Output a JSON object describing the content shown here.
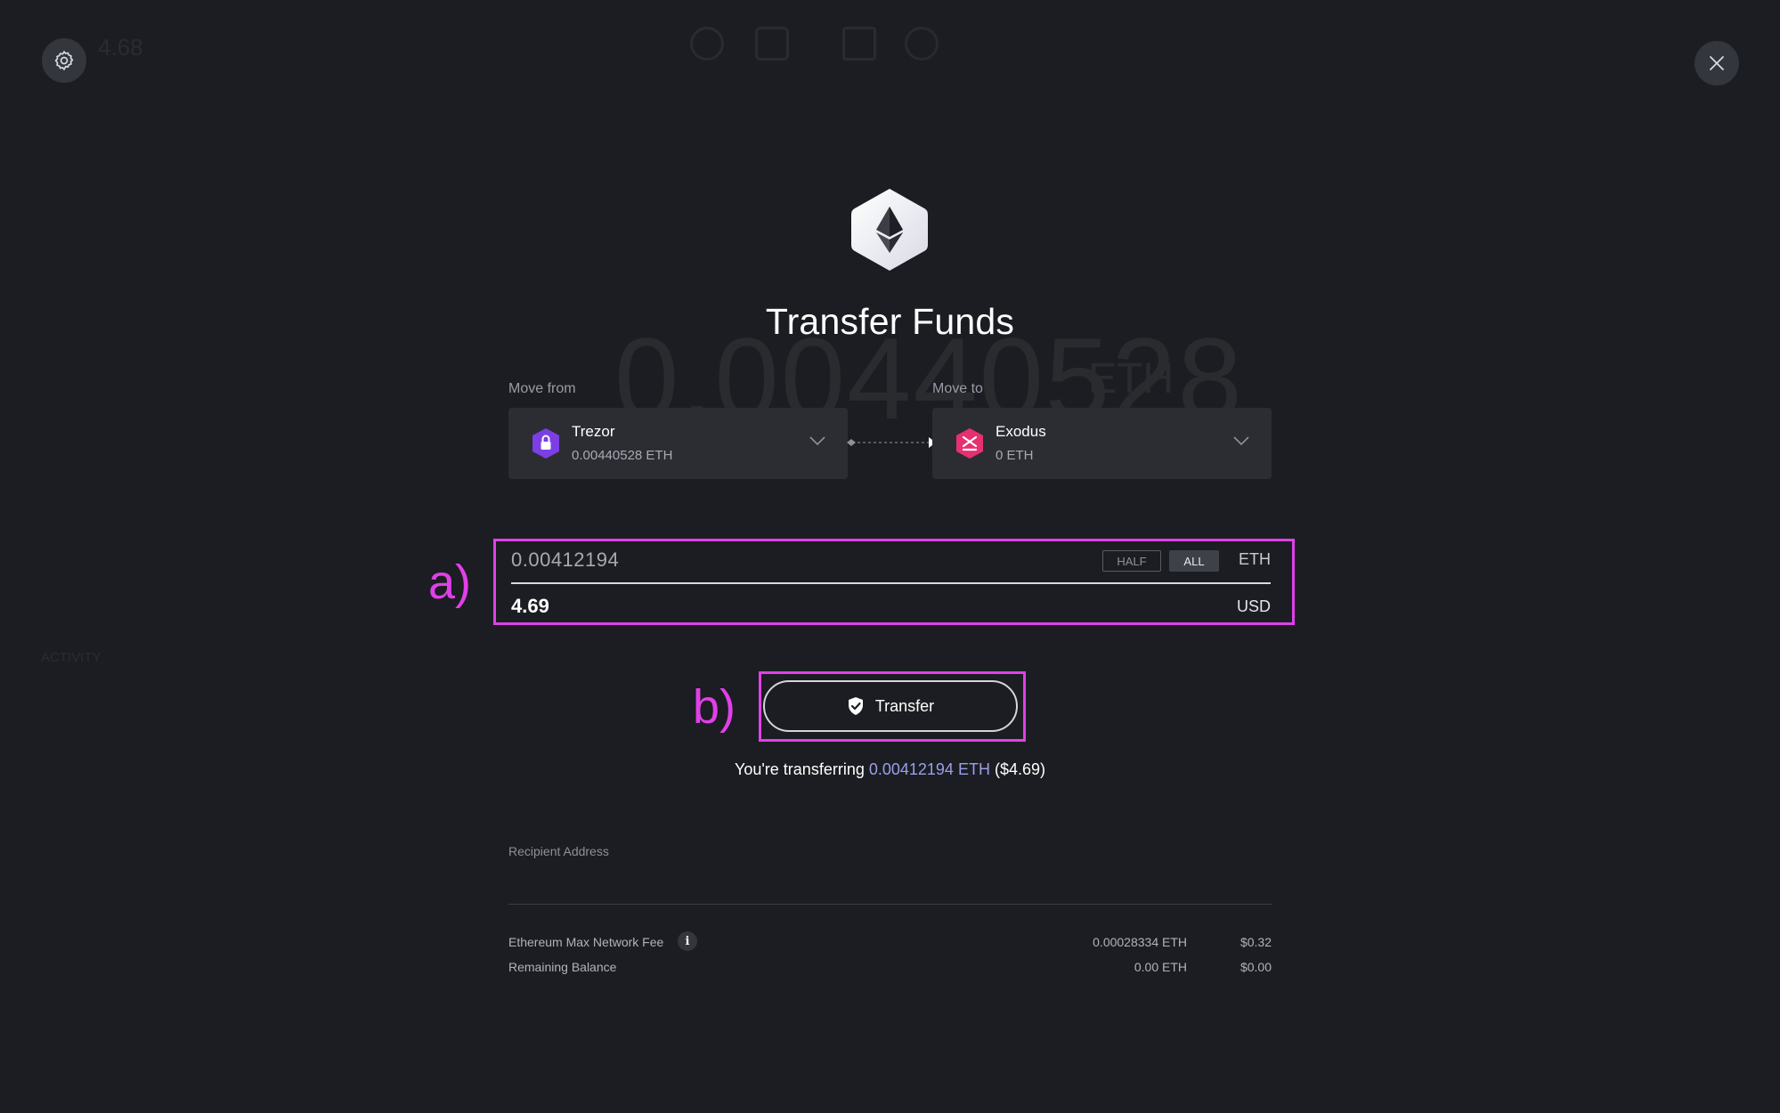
{
  "background": {
    "header_balance": "4.68",
    "big_balance": "0.00440528",
    "big_balance_unit": "ETH",
    "activity_tab": "ACTIVITY"
  },
  "header": {
    "settings_icon": "gear-icon",
    "close_icon": "close-icon"
  },
  "modal": {
    "title": "Transfer Funds",
    "asset_icon": "ethereum-logo-icon",
    "move_from": {
      "label": "Move from",
      "wallet_name": "Trezor",
      "balance": "0.00440528 ETH",
      "icon": "trezor-lock-icon"
    },
    "move_to": {
      "label": "Move to",
      "wallet_name": "Exodus",
      "balance": "0 ETH",
      "icon": "exodus-logo-icon"
    },
    "amount": {
      "crypto_value": "0.00412194",
      "half_label": "HALF",
      "all_label": "ALL",
      "crypto_unit": "ETH",
      "fiat_value": "4.69",
      "fiat_unit": "USD"
    },
    "transfer_button": "Transfer",
    "summary": {
      "prefix": "You're transferring ",
      "amount": "0.00412194 ETH",
      "fiat": " ($4.69)"
    },
    "recipient": {
      "label": "Recipient Address",
      "value": ""
    },
    "fees": [
      {
        "label": "Ethereum Max Network Fee",
        "crypto": "0.00028334 ETH",
        "fiat": "$0.32"
      },
      {
        "label": "Remaining Balance",
        "crypto": "0.00 ETH",
        "fiat": "$0.00"
      }
    ]
  },
  "annotations": {
    "a": "a)",
    "b": "b)"
  },
  "colors": {
    "background": "#1c1d22",
    "card": "#2b2d33",
    "annotation_highlight": "#e040e8",
    "accent_text": "#9b9fe8",
    "trezor_purple": "#7b3fe4",
    "exodus_pink": "#e6306f"
  }
}
